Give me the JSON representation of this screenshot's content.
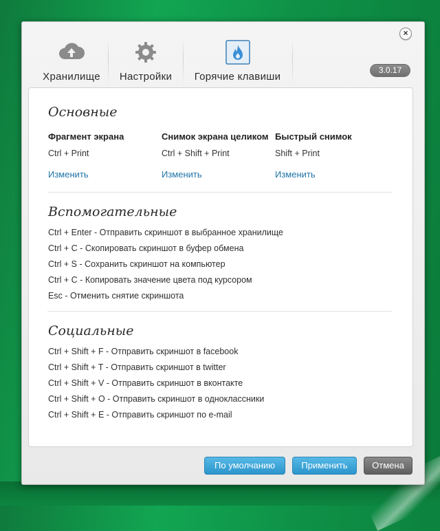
{
  "window": {
    "version": "3.0.17",
    "close_glyph": "×"
  },
  "tabs": [
    {
      "label": "Хранилище",
      "icon": "cloud-upload-icon"
    },
    {
      "label": "Настройки",
      "icon": "gear-icon"
    },
    {
      "label": "Горячие клавиши",
      "icon": "flame-icon",
      "active": true
    }
  ],
  "main": {
    "title": "Основные",
    "columns": [
      {
        "header": "Фрагмент экрана",
        "shortcut": "Ctrl + Print",
        "change": "Изменить"
      },
      {
        "header": "Снимок экрана целиком",
        "shortcut": "Ctrl + Shift + Print",
        "change": "Изменить"
      },
      {
        "header": "Быстрый снимок",
        "shortcut": "Shift + Print",
        "change": "Изменить"
      }
    ]
  },
  "aux": {
    "title": "Вспомогательные",
    "items": [
      "Ctrl + Enter - Отправить скриншот в выбранное хранилище",
      "Ctrl + C - Скопировать скриншот в буфер обмена",
      "Ctrl + S - Сохранить скриншот на компьютер",
      "Ctrl + C - Копировать значение цвета под курсором",
      "Esc - Отменить снятие скриншота"
    ]
  },
  "social": {
    "title": "Социальные",
    "items": [
      "Ctrl + Shift + F - Отправить скриншот в facebook",
      "Ctrl + Shift + T - Отправить скриншот в twitter",
      "Ctrl + Shift + V - Отправить скриншот в вконтакте",
      "Ctrl + Shift + O - Отправить скриншот в одноклассники",
      "Ctrl + Shift + E - Отправить скриншот по e-mail"
    ]
  },
  "footer": {
    "defaults_label": "По умолчанию",
    "apply_label": "Применить",
    "cancel_label": "Отмена"
  },
  "colors": {
    "link": "#1f74a8",
    "accent_blue": "#2b95cc",
    "flame": "#3a8fd6"
  }
}
